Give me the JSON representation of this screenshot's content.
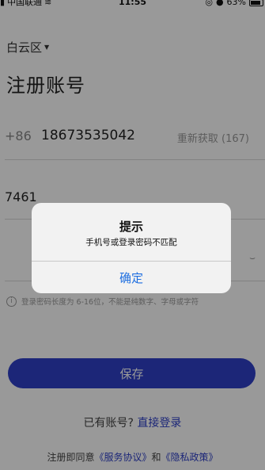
{
  "status_bar": {
    "carrier": "中国联通",
    "time": "11:55",
    "battery": "63%"
  },
  "region": {
    "label": "白云区"
  },
  "page_title": "注册账号",
  "phone_row": {
    "country_code": "+86",
    "phone_number": "18673535042",
    "resend_label": "重新获取 (167)"
  },
  "verification_code": "7461",
  "password_hint": "登录密码长度为 6-16位，不能是纯数字、字母或字符",
  "save_button": "保存",
  "login_row": {
    "prefix": "已有账号?",
    "link": "直接登录"
  },
  "agreement": {
    "prefix": "注册即同意",
    "service_link": "《服务协议》",
    "and": "和",
    "privacy_link": "《隐私政策》"
  },
  "dialog": {
    "title": "提示",
    "message": "手机号或登录密码不匹配",
    "confirm_button": "确定"
  },
  "colors": {
    "accent": "#2f40c8",
    "dialog_button": "#1f6fe0"
  }
}
